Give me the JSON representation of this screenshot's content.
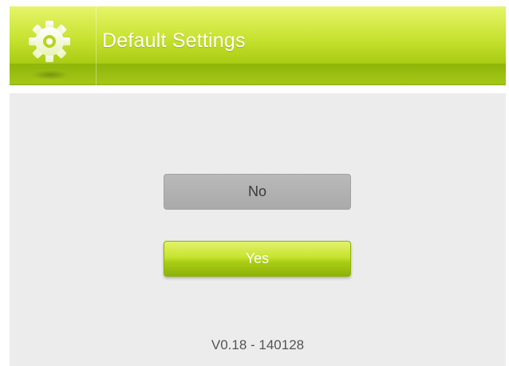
{
  "header": {
    "title": "Default Settings",
    "icon": "gear-icon"
  },
  "buttons": {
    "no_label": "No",
    "yes_label": "Yes"
  },
  "footer": {
    "version": "V0.18 - 140128"
  },
  "colors": {
    "accent": "#b4d61c",
    "neutral_button": "#b0b0b0",
    "background": "#ececec"
  }
}
